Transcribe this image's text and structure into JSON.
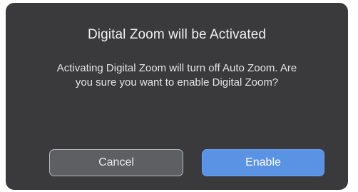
{
  "dialog": {
    "title": "Digital Zoom will be Activated",
    "message": "Activating Digital Zoom will turn off Auto Zoom. Are you sure you want to enable Digital Zoom?",
    "cancel_label": "Cancel",
    "enable_label": "Enable",
    "colors": {
      "background": "#3a3a3d",
      "cancel_button": "#5e5f63",
      "enable_button": "#5b93e4"
    }
  }
}
